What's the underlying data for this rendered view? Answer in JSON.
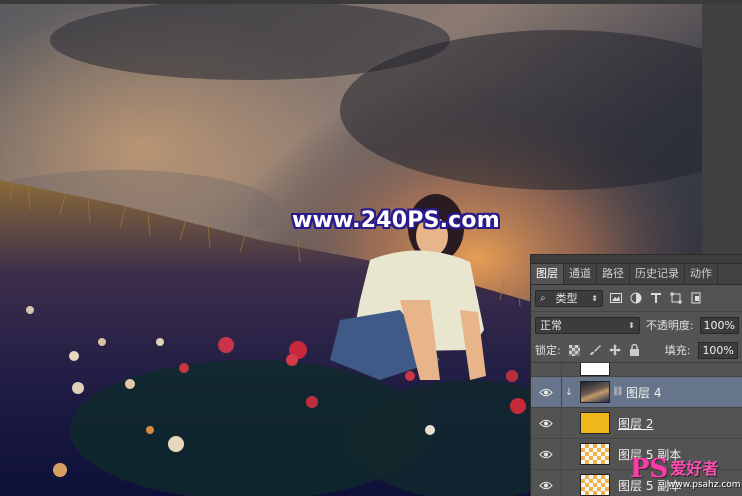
{
  "watermark": {
    "text": "www.240PS.com"
  },
  "layers_panel": {
    "tabs": [
      {
        "label": "图层",
        "active": true
      },
      {
        "label": "通道",
        "active": false
      },
      {
        "label": "路径",
        "active": false
      },
      {
        "label": "历史记录",
        "active": false
      },
      {
        "label": "动作",
        "active": false
      }
    ],
    "filter": {
      "value": "类型",
      "icons": [
        "image-filter-icon",
        "adjustment-filter-icon",
        "type-filter-icon",
        "shape-filter-icon",
        "smart-object-filter-icon"
      ]
    },
    "blend_mode": "正常",
    "opacity_label": "不透明度:",
    "opacity_value": "100%",
    "lock_label": "锁定:",
    "fill_label": "填充:",
    "fill_value": "100%",
    "layers": [
      {
        "name": "",
        "thumb": "white",
        "partial": true
      },
      {
        "name": "图层 4",
        "thumb": "photo",
        "selected": true,
        "clipped": true
      },
      {
        "name": "图层 2",
        "thumb": "gold",
        "underline": true
      },
      {
        "name": "图层 5 副本",
        "thumb": "checker"
      },
      {
        "name": "图层 5 副本",
        "thumb": "checker"
      }
    ]
  },
  "logo": {
    "ps": "PS",
    "text": "爱好者",
    "url": "www.psahz.com"
  },
  "colors": {
    "panel_bg": "#535353",
    "selected_layer": "#667589",
    "watermark_outline": "#2a1b8c"
  }
}
